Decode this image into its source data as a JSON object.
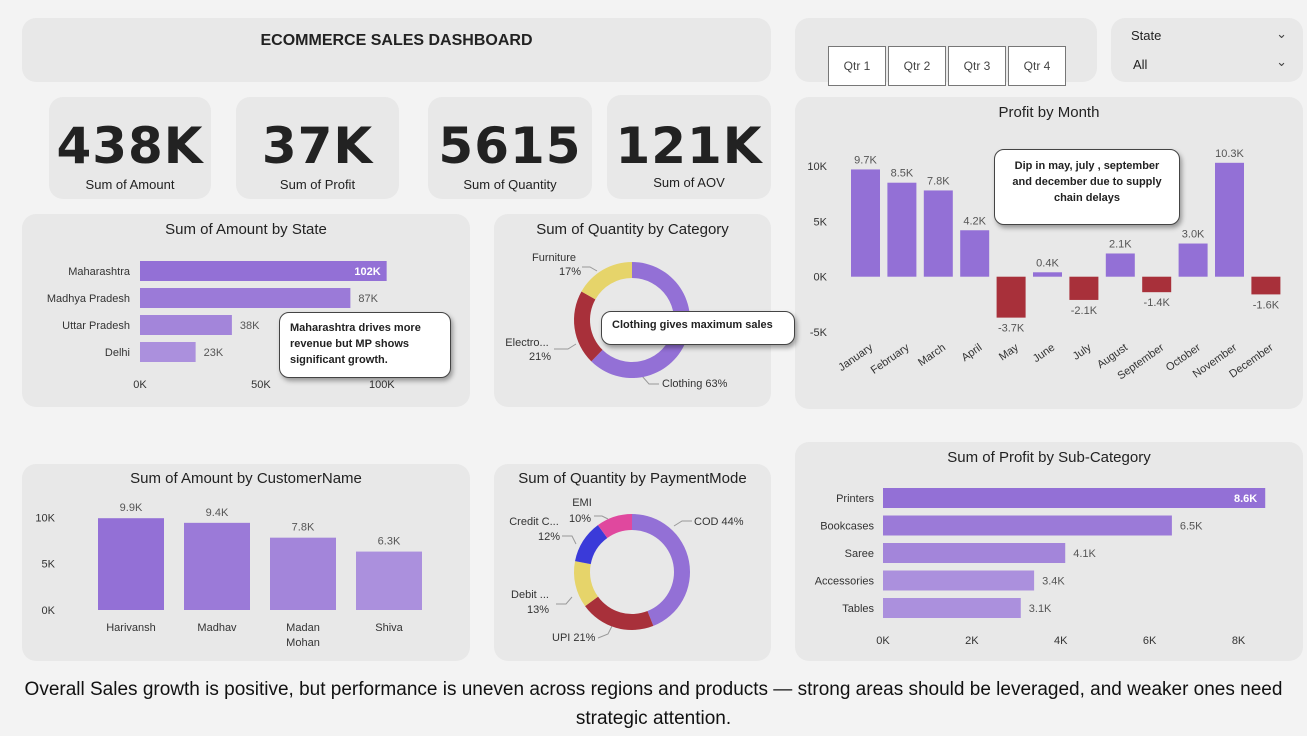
{
  "header": {
    "title": "ECOMMERCE SALES DASHBOARD"
  },
  "slicer": {
    "buttons": [
      "Qtr 1",
      "Qtr 2",
      "Qtr 3",
      "Qtr 4"
    ]
  },
  "state_filter": {
    "label": "State",
    "value": "All"
  },
  "kpis": [
    {
      "value": "438K",
      "label": "Sum of Amount"
    },
    {
      "value": "37K",
      "label": "Sum of Profit"
    },
    {
      "value": "5615",
      "label": "Sum of Quantity"
    },
    {
      "value": "121K",
      "label": "Sum of AOV"
    }
  ],
  "colors": {
    "primary": "#9370d6",
    "light": "#a98ddb",
    "negative": "#a8303a",
    "yellow": "#e6d46a",
    "pink": "#e0489e",
    "blue": "#3a3ad9"
  },
  "callouts": {
    "state": "Maharashtra drives more revenue but MP shows significant growth.",
    "category": "Clothing gives maximum sales",
    "month": "Dip in may, july , september and december due to supply chain delays"
  },
  "footer": {
    "text": "Overall Sales growth is positive, but performance is uneven across regions and products — strong areas should be leveraged, and weaker ones need strategic attention."
  },
  "chart_data": [
    {
      "id": "amount_by_state",
      "type": "bar",
      "orientation": "horizontal",
      "title": "Sum of Amount by State",
      "categories": [
        "Maharashtra",
        "Madhya Pradesh",
        "Uttar Pradesh",
        "Delhi"
      ],
      "values": [
        102000,
        87000,
        38000,
        23000
      ],
      "labels": [
        "102K",
        "87K",
        "38K",
        "23K"
      ],
      "xlim": [
        0,
        110000
      ],
      "ticks": [
        0,
        50000,
        100000
      ],
      "tick_labels": [
        "0K",
        "50K",
        "100K"
      ]
    },
    {
      "id": "quantity_by_category",
      "type": "pie",
      "donut": true,
      "title": "Sum of Quantity by Category",
      "slices": [
        {
          "name": "Clothing",
          "value": 63,
          "label": "Clothing 63%"
        },
        {
          "name": "Electro...",
          "value": 21,
          "label": "21%"
        },
        {
          "name": "Furniture",
          "value": 17,
          "label": "17%"
        }
      ]
    },
    {
      "id": "profit_by_month",
      "type": "bar",
      "title": "Profit by Month",
      "categories": [
        "January",
        "February",
        "March",
        "April",
        "May",
        "June",
        "July",
        "August",
        "September",
        "October",
        "November",
        "December"
      ],
      "values": [
        9700,
        8500,
        7800,
        4200,
        -3700,
        400,
        -2100,
        2100,
        -1400,
        3000,
        10300,
        -1600
      ],
      "labels": [
        "9.7K",
        "8.5K",
        "7.8K",
        "4.2K",
        "-3.7K",
        "0.4K",
        "-2.1K",
        "2.1K",
        "-1.4K",
        "3.0K",
        "10.3K",
        "-1.6K"
      ],
      "ylim": [
        -5000,
        12000
      ],
      "ticks": [
        -5000,
        0,
        5000,
        10000
      ],
      "tick_labels": [
        "-5K",
        "0K",
        "5K",
        "10K"
      ]
    },
    {
      "id": "amount_by_customer",
      "type": "bar",
      "title": "Sum of Amount by CustomerName",
      "categories": [
        "Harivansh",
        "Madhav",
        "Madan Mohan",
        "Shiva"
      ],
      "values": [
        9900,
        9400,
        7800,
        6300
      ],
      "labels": [
        "9.9K",
        "9.4K",
        "7.8K",
        "6.3K"
      ],
      "ylim": [
        0,
        11000
      ],
      "ticks": [
        0,
        5000,
        10000
      ],
      "tick_labels": [
        "0K",
        "5K",
        "10K"
      ]
    },
    {
      "id": "quantity_by_payment",
      "type": "pie",
      "donut": true,
      "title": "Sum of Quantity by PaymentMode",
      "slices": [
        {
          "name": "COD",
          "value": 44,
          "label": "COD 44%"
        },
        {
          "name": "UPI",
          "value": 21,
          "label": "UPI 21%"
        },
        {
          "name": "Debit ...",
          "value": 13,
          "label": "13%"
        },
        {
          "name": "Credit C...",
          "value": 12,
          "label": "12%"
        },
        {
          "name": "EMI",
          "value": 10,
          "label": "10%"
        }
      ]
    },
    {
      "id": "profit_by_subcategory",
      "type": "bar",
      "orientation": "horizontal",
      "title": "Sum of Profit by Sub-Category",
      "categories": [
        "Printers",
        "Bookcases",
        "Saree",
        "Accessories",
        "Tables"
      ],
      "values": [
        8600,
        6500,
        4100,
        3400,
        3100
      ],
      "labels": [
        "8.6K",
        "6.5K",
        "4.1K",
        "3.4K",
        "3.1K"
      ],
      "xlim": [
        0,
        9000
      ],
      "ticks": [
        0,
        2000,
        4000,
        6000,
        8000
      ],
      "tick_labels": [
        "0K",
        "2K",
        "4K",
        "6K",
        "8K"
      ]
    }
  ]
}
